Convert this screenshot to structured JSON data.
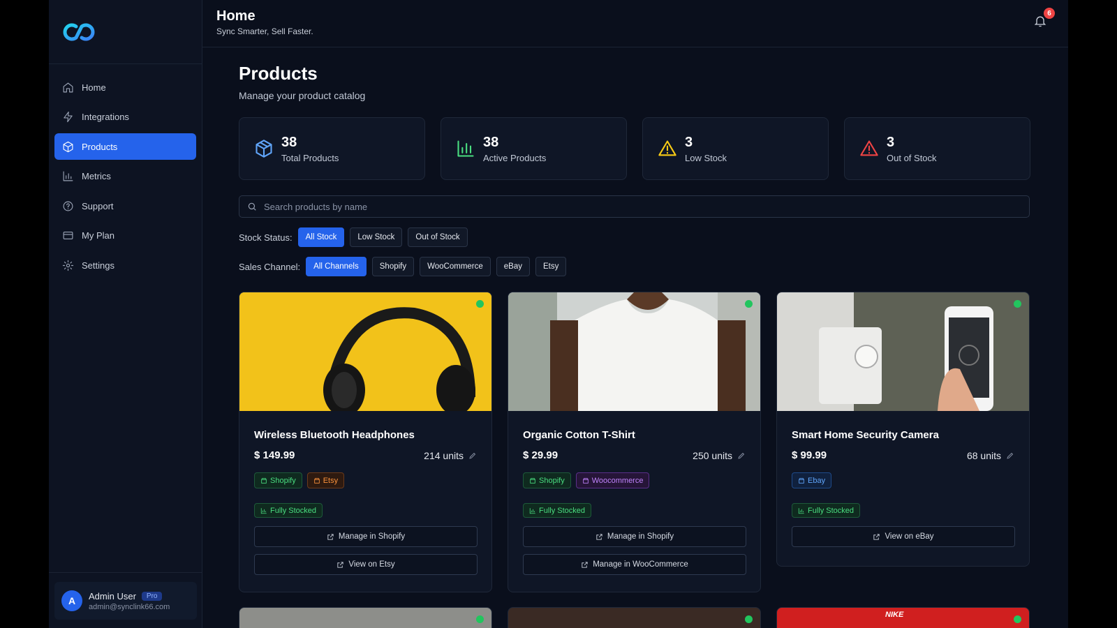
{
  "header": {
    "title": "Home",
    "subtitle": "Sync Smarter, Sell Faster.",
    "notification_count": "6"
  },
  "sidebar": {
    "items": [
      {
        "label": "Home",
        "icon": "home-icon"
      },
      {
        "label": "Integrations",
        "icon": "bolt-icon"
      },
      {
        "label": "Products",
        "icon": "box-icon",
        "active": true
      },
      {
        "label": "Metrics",
        "icon": "bar-chart-icon"
      },
      {
        "label": "Support",
        "icon": "help-circle-icon"
      },
      {
        "label": "My Plan",
        "icon": "credit-card-icon"
      },
      {
        "label": "Settings",
        "icon": "gear-icon"
      }
    ],
    "user": {
      "initial": "A",
      "name": "Admin User",
      "plan": "Pro",
      "email": "admin@synclink66.com"
    }
  },
  "page": {
    "title": "Products",
    "subtitle": "Manage your product catalog"
  },
  "stats": [
    {
      "value": "38",
      "label": "Total Products",
      "icon": "box-icon",
      "color": "#60a5fa"
    },
    {
      "value": "38",
      "label": "Active Products",
      "icon": "bar-chart-icon",
      "color": "#4ade80"
    },
    {
      "value": "3",
      "label": "Low Stock",
      "icon": "warning-icon",
      "color": "#facc15"
    },
    {
      "value": "3",
      "label": "Out of Stock",
      "icon": "alert-icon",
      "color": "#ef4444"
    }
  ],
  "search": {
    "placeholder": "Search products by name"
  },
  "filters": {
    "stock_label": "Stock Status:",
    "stock_options": [
      "All Stock",
      "Low Stock",
      "Out of Stock"
    ],
    "channel_label": "Sales Channel:",
    "channel_options": [
      "All Channels",
      "Shopify",
      "WooCommerce",
      "eBay",
      "Etsy"
    ]
  },
  "products": [
    {
      "name": "Wireless Bluetooth Headphones",
      "price": "$ 149.99",
      "units": "214 units",
      "channels": [
        {
          "label": "Shopify",
          "kind": "shopify"
        },
        {
          "label": "Etsy",
          "kind": "etsy"
        }
      ],
      "stock": "Fully Stocked",
      "actions": [
        "Manage in Shopify",
        "View on Etsy"
      ]
    },
    {
      "name": "Organic Cotton T-Shirt",
      "price": "$ 29.99",
      "units": "250 units",
      "channels": [
        {
          "label": "Shopify",
          "kind": "shopify"
        },
        {
          "label": "Woocommerce",
          "kind": "woo"
        }
      ],
      "stock": "Fully Stocked",
      "actions": [
        "Manage in Shopify",
        "Manage in WooCommerce"
      ]
    },
    {
      "name": "Smart Home Security Camera",
      "price": "$ 99.99",
      "units": "68 units",
      "channels": [
        {
          "label": "Ebay",
          "kind": "ebay"
        }
      ],
      "stock": "Fully Stocked",
      "actions": [
        "View on eBay"
      ]
    }
  ],
  "partial_row_brand": "NIKE"
}
